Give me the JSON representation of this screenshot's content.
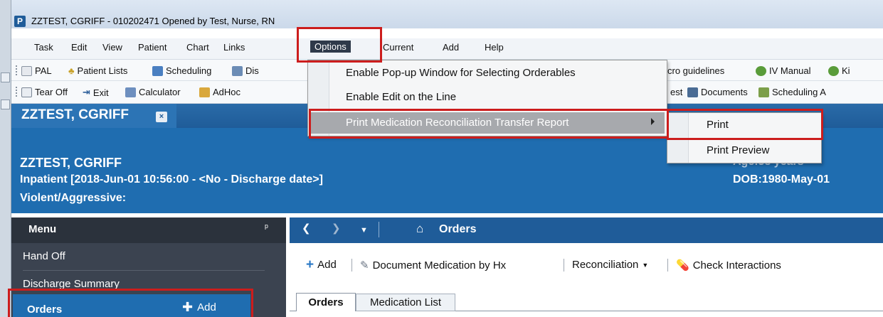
{
  "window": {
    "title": "ZZTEST, CGRIFF - 010202471 Opened by Test, Nurse, RN",
    "app_icon": "P"
  },
  "menubar": {
    "items": [
      "Task",
      "Edit",
      "View",
      "Patient",
      "Chart",
      "Links",
      "Options",
      "Current",
      "Add",
      "Help"
    ]
  },
  "toolbar1": {
    "pal": "PAL",
    "patient_lists": "Patient Lists",
    "scheduling": "Scheduling",
    "dis": "Dis",
    "micro_guidelines": "cro guidelines",
    "iv_manual": "IV Manual",
    "ki": "Ki"
  },
  "toolbar2": {
    "tear_off": "Tear Off",
    "exit": "Exit",
    "calculator": "Calculator",
    "adhoc": "AdHoc",
    "est": "est",
    "documents": "Documents",
    "scheduling_a": "Scheduling A"
  },
  "options_menu": {
    "items": [
      "Enable Pop-up Window for Selecting Orderables",
      "Enable Edit on the Line",
      "Print Medication Reconciliation Transfer Report"
    ],
    "submenu": [
      "Print",
      "Print Preview"
    ]
  },
  "patient_tab": {
    "label": "ZZTEST, CGRIFF",
    "close": "×"
  },
  "banner": {
    "name": "ZZTEST, CGRIFF",
    "encounter": "Inpatient [2018-Jun-01 10:56:00 - <No - Discharge date>]",
    "alert": "Violent/Aggressive:",
    "age": "Age:38 years",
    "dob": "DOB:1980-May-01"
  },
  "side_menu": {
    "header": "Menu",
    "pin": "ᵖ",
    "items": [
      "Hand Off",
      "Discharge Summary"
    ],
    "active_item": "Orders",
    "add_label": "Add"
  },
  "orders_panel": {
    "title": "Orders",
    "toolbar": {
      "add": "Add",
      "document_med": "Document Medication by Hx",
      "reconciliation": "Reconciliation",
      "check_interactions": "Check Interactions"
    },
    "tabs": [
      "Orders",
      "Medication List"
    ]
  },
  "colors": {
    "banner_blue": "#1f6db0",
    "highlight_red": "#cc1d1d",
    "menu_dark": "#3b4350"
  }
}
